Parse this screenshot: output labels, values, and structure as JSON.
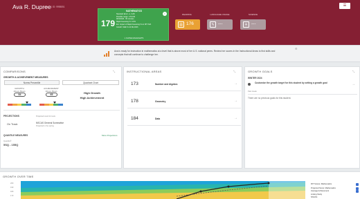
{
  "student": {
    "name": "Ava R. Dupree",
    "grade_info": "Grade 3 | ID: 9998851"
  },
  "menu_icon": "menu-icon",
  "math_card": {
    "title": "MATHEMATICS",
    "score": "179",
    "lines": [
      "Standard Error: +/- 3.28",
      "Possible range: 176-182",
      "9/15/2023 - 50 minutes",
      "Rapid Guessing %: 0.0%",
      "Est. Impact of Rapid Guessing % on RIT: N/A",
      "Growth: Math K-12 NE 2023"
    ],
    "link": "▾ CLOSE HIGHLIGHTS"
  },
  "subjects": [
    {
      "label": "READING",
      "value": "176",
      "color": "#e9a134",
      "icon": "book-icon"
    },
    {
      "label": "LANGUAGE USAGE",
      "value": "---",
      "color": "#ad9b9f",
      "icon": "pencil-icon"
    },
    {
      "label": "SCIENCE",
      "value": "---",
      "color": "#ad9b9f",
      "icon": "atom-icon"
    }
  ],
  "message": {
    "text": "Ava is ready for instruction in mathematics at a level that is above most of her U.S. national peers. Review her scores in the Instructional Areas to find skills and concepts that will continue to challenge her."
  },
  "comparisons": {
    "title": "COMPARISONS",
    "subtitle": "GROWTH & ACHIEVEMENT MEASURES",
    "tab_left": "Norms Percentile",
    "tab_right": "Quadrant Chart",
    "growth_label": "GROWTH",
    "growth_sub": "Above Mean",
    "growth_value": "84",
    "ach_label": "ACHIEVEMENT",
    "ach_sub": "Above Mean",
    "ach_value": "65",
    "quad_growth": "High Growth",
    "quad_ach": "High Achievement",
    "projections_label": "PROJECTIONS",
    "projections_sub": "Projected result for tests",
    "on_track": "On Track",
    "proj_test": "NSCAS General Summative",
    "proj_when": "Projected in the spring",
    "more_proj": "More Projections",
    "quantile_label": "QUANTILE MEASURES",
    "quantile_sub": "Quantile®",
    "quantile_value": "5SQ - 155Q"
  },
  "instructional": {
    "title": "INSTRUCTIONAL AREAS",
    "rows": [
      {
        "score": "173",
        "name": "Number and Algebra"
      },
      {
        "score": "178",
        "name": "Geometry"
      },
      {
        "score": "184",
        "name": "Data"
      }
    ]
  },
  "goals": {
    "title": "GROWTH GOALS",
    "season": "WINTER 2024",
    "goal_text": "Customize the growth target for this student by setting a growth goal",
    "past": "Past Goals",
    "none": "There are no previous goals for this student."
  },
  "growth_over_time": {
    "title": "GROWTH OVER TIME",
    "y_ticks": [
      "200",
      "190",
      "180",
      "170"
    ],
    "legend": [
      {
        "label": "RIT Scores: Mathematics",
        "checked": true
      },
      {
        "label": "Projected Score: Mathematics",
        "checked": true
      },
      {
        "label": "Average Achievement",
        "checked": true
      },
      {
        "label": "Linking Study",
        "checked": false
      },
      {
        "label": "NSCAS",
        "checked": false
      }
    ]
  },
  "colors": {
    "header": "#851f33",
    "math": "#3fa34d",
    "chart_bg": "#1fa3d9"
  }
}
